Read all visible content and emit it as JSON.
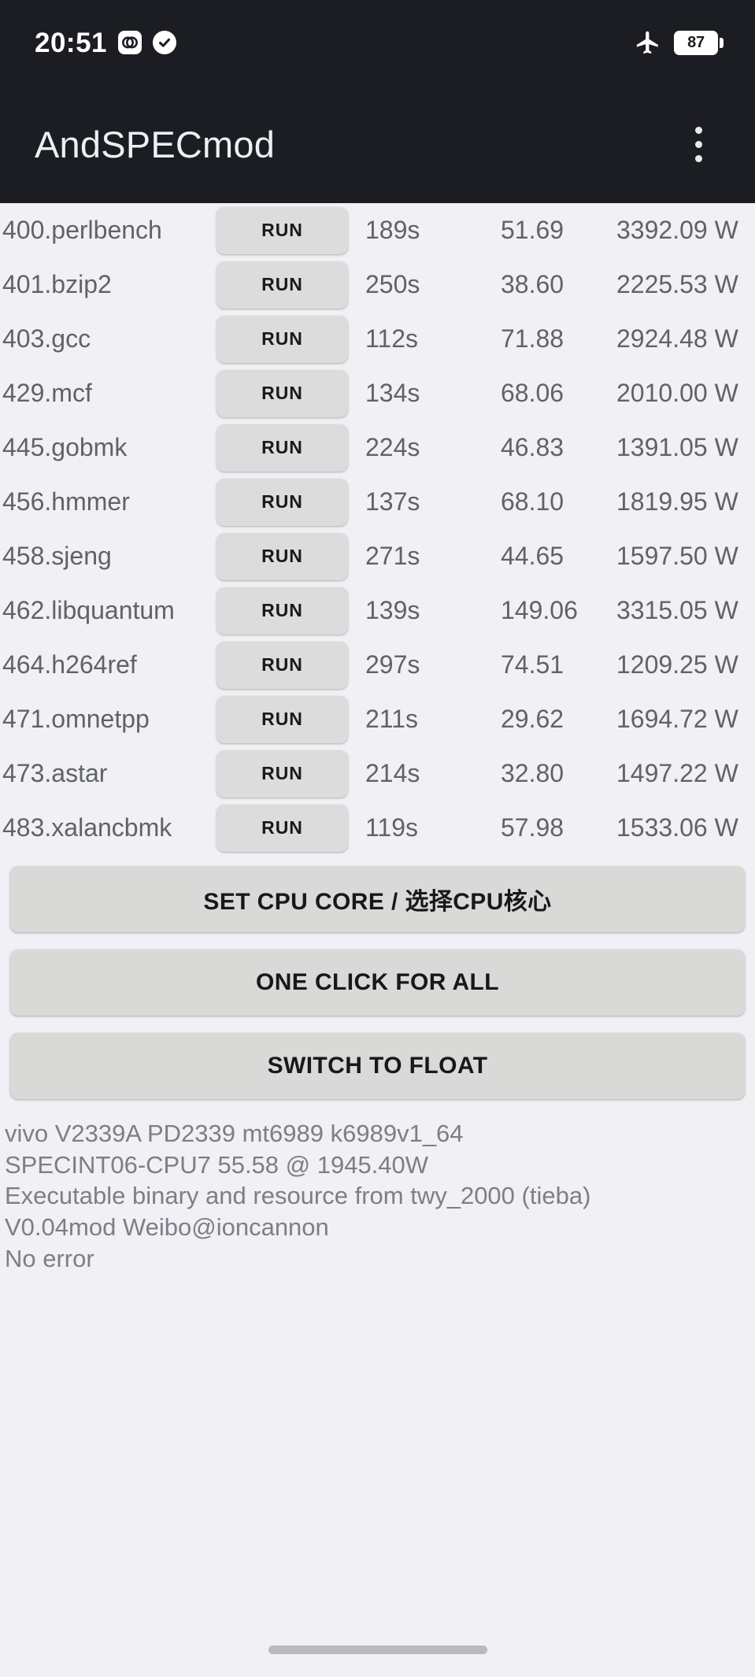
{
  "status_bar": {
    "time": "20:51",
    "icons": [
      "vivo-logo-icon",
      "check-circle-icon"
    ],
    "airplane_icon": "airplane-mode-icon",
    "battery_level": "87"
  },
  "app_bar": {
    "title": "AndSPECmod",
    "overflow_icon": "more-vertical-icon"
  },
  "benchmark_table": {
    "run_label": "RUN",
    "rows": [
      {
        "name": "400.perlbench",
        "time": "189s",
        "score": "51.69",
        "power": "3392.09 W"
      },
      {
        "name": "401.bzip2",
        "time": "250s",
        "score": "38.60",
        "power": "2225.53 W"
      },
      {
        "name": "403.gcc",
        "time": "112s",
        "score": "71.88",
        "power": "2924.48 W"
      },
      {
        "name": "429.mcf",
        "time": "134s",
        "score": "68.06",
        "power": "2010.00 W"
      },
      {
        "name": "445.gobmk",
        "time": "224s",
        "score": "46.83",
        "power": "1391.05 W"
      },
      {
        "name": "456.hmmer",
        "time": "137s",
        "score": "68.10",
        "power": "1819.95 W"
      },
      {
        "name": "458.sjeng",
        "time": "271s",
        "score": "44.65",
        "power": "1597.50 W"
      },
      {
        "name": "462.libquantum",
        "time": "139s",
        "score": "149.06",
        "power": "3315.05 W"
      },
      {
        "name": "464.h264ref",
        "time": "297s",
        "score": "74.51",
        "power": "1209.25 W"
      },
      {
        "name": "471.omnetpp",
        "time": "211s",
        "score": "29.62",
        "power": "1694.72 W"
      },
      {
        "name": "473.astar",
        "time": "214s",
        "score": "32.80",
        "power": "1497.22 W"
      },
      {
        "name": "483.xalancbmk",
        "time": "119s",
        "score": "57.98",
        "power": "1533.06 W"
      }
    ]
  },
  "actions": {
    "set_cpu_core": "SET CPU CORE / 选择CPU核心",
    "one_click_for_all": "ONE CLICK FOR ALL",
    "switch_to_float": "SWITCH TO FLOAT"
  },
  "info": {
    "device": "vivo V2339A PD2339 mt6989 k6989v1_64",
    "result": "SPECINT06-CPU7  55.58 @ 1945.40W",
    "credit": "Executable binary and resource from twy_2000 (tieba)",
    "version": "V0.04mod  Weibo@ioncannon",
    "error": "No error"
  },
  "colors": {
    "appbar_bg": "#1c1d22",
    "page_bg": "#f0f0f5",
    "button_bg": "#d9dad8",
    "text_muted": "#5f6368"
  }
}
